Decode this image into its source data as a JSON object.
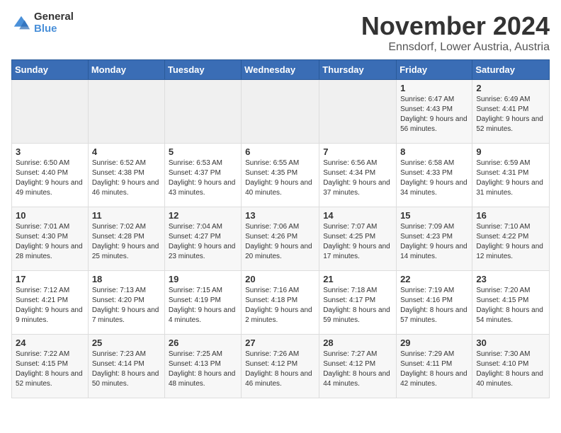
{
  "header": {
    "logo_general": "General",
    "logo_blue": "Blue",
    "month_title": "November 2024",
    "location": "Ennsdorf, Lower Austria, Austria"
  },
  "weekdays": [
    "Sunday",
    "Monday",
    "Tuesday",
    "Wednesday",
    "Thursday",
    "Friday",
    "Saturday"
  ],
  "weeks": [
    [
      {
        "day": "",
        "info": ""
      },
      {
        "day": "",
        "info": ""
      },
      {
        "day": "",
        "info": ""
      },
      {
        "day": "",
        "info": ""
      },
      {
        "day": "",
        "info": ""
      },
      {
        "day": "1",
        "info": "Sunrise: 6:47 AM\nSunset: 4:43 PM\nDaylight: 9 hours and 56 minutes."
      },
      {
        "day": "2",
        "info": "Sunrise: 6:49 AM\nSunset: 4:41 PM\nDaylight: 9 hours and 52 minutes."
      }
    ],
    [
      {
        "day": "3",
        "info": "Sunrise: 6:50 AM\nSunset: 4:40 PM\nDaylight: 9 hours and 49 minutes."
      },
      {
        "day": "4",
        "info": "Sunrise: 6:52 AM\nSunset: 4:38 PM\nDaylight: 9 hours and 46 minutes."
      },
      {
        "day": "5",
        "info": "Sunrise: 6:53 AM\nSunset: 4:37 PM\nDaylight: 9 hours and 43 minutes."
      },
      {
        "day": "6",
        "info": "Sunrise: 6:55 AM\nSunset: 4:35 PM\nDaylight: 9 hours and 40 minutes."
      },
      {
        "day": "7",
        "info": "Sunrise: 6:56 AM\nSunset: 4:34 PM\nDaylight: 9 hours and 37 minutes."
      },
      {
        "day": "8",
        "info": "Sunrise: 6:58 AM\nSunset: 4:33 PM\nDaylight: 9 hours and 34 minutes."
      },
      {
        "day": "9",
        "info": "Sunrise: 6:59 AM\nSunset: 4:31 PM\nDaylight: 9 hours and 31 minutes."
      }
    ],
    [
      {
        "day": "10",
        "info": "Sunrise: 7:01 AM\nSunset: 4:30 PM\nDaylight: 9 hours and 28 minutes."
      },
      {
        "day": "11",
        "info": "Sunrise: 7:02 AM\nSunset: 4:28 PM\nDaylight: 9 hours and 25 minutes."
      },
      {
        "day": "12",
        "info": "Sunrise: 7:04 AM\nSunset: 4:27 PM\nDaylight: 9 hours and 23 minutes."
      },
      {
        "day": "13",
        "info": "Sunrise: 7:06 AM\nSunset: 4:26 PM\nDaylight: 9 hours and 20 minutes."
      },
      {
        "day": "14",
        "info": "Sunrise: 7:07 AM\nSunset: 4:25 PM\nDaylight: 9 hours and 17 minutes."
      },
      {
        "day": "15",
        "info": "Sunrise: 7:09 AM\nSunset: 4:23 PM\nDaylight: 9 hours and 14 minutes."
      },
      {
        "day": "16",
        "info": "Sunrise: 7:10 AM\nSunset: 4:22 PM\nDaylight: 9 hours and 12 minutes."
      }
    ],
    [
      {
        "day": "17",
        "info": "Sunrise: 7:12 AM\nSunset: 4:21 PM\nDaylight: 9 hours and 9 minutes."
      },
      {
        "day": "18",
        "info": "Sunrise: 7:13 AM\nSunset: 4:20 PM\nDaylight: 9 hours and 7 minutes."
      },
      {
        "day": "19",
        "info": "Sunrise: 7:15 AM\nSunset: 4:19 PM\nDaylight: 9 hours and 4 minutes."
      },
      {
        "day": "20",
        "info": "Sunrise: 7:16 AM\nSunset: 4:18 PM\nDaylight: 9 hours and 2 minutes."
      },
      {
        "day": "21",
        "info": "Sunrise: 7:18 AM\nSunset: 4:17 PM\nDaylight: 8 hours and 59 minutes."
      },
      {
        "day": "22",
        "info": "Sunrise: 7:19 AM\nSunset: 4:16 PM\nDaylight: 8 hours and 57 minutes."
      },
      {
        "day": "23",
        "info": "Sunrise: 7:20 AM\nSunset: 4:15 PM\nDaylight: 8 hours and 54 minutes."
      }
    ],
    [
      {
        "day": "24",
        "info": "Sunrise: 7:22 AM\nSunset: 4:15 PM\nDaylight: 8 hours and 52 minutes."
      },
      {
        "day": "25",
        "info": "Sunrise: 7:23 AM\nSunset: 4:14 PM\nDaylight: 8 hours and 50 minutes."
      },
      {
        "day": "26",
        "info": "Sunrise: 7:25 AM\nSunset: 4:13 PM\nDaylight: 8 hours and 48 minutes."
      },
      {
        "day": "27",
        "info": "Sunrise: 7:26 AM\nSunset: 4:12 PM\nDaylight: 8 hours and 46 minutes."
      },
      {
        "day": "28",
        "info": "Sunrise: 7:27 AM\nSunset: 4:12 PM\nDaylight: 8 hours and 44 minutes."
      },
      {
        "day": "29",
        "info": "Sunrise: 7:29 AM\nSunset: 4:11 PM\nDaylight: 8 hours and 42 minutes."
      },
      {
        "day": "30",
        "info": "Sunrise: 7:30 AM\nSunset: 4:10 PM\nDaylight: 8 hours and 40 minutes."
      }
    ]
  ]
}
